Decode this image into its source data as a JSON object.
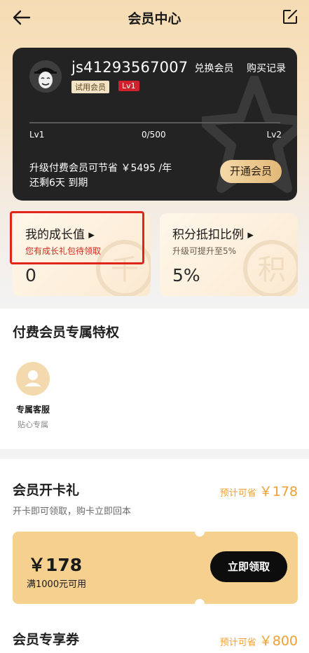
{
  "header": {
    "title": "会员中心"
  },
  "card": {
    "username": "js41293567007",
    "badge_trial": "试用会员",
    "badge_level": "Lv1",
    "link_exchange": "兑换会员",
    "link_records": "购买记录",
    "progress": {
      "current": 0,
      "max": 500
    },
    "level_left": "Lv1",
    "progress_text": "0/500",
    "level_right": "Lv2",
    "save_text": "升级付费会员可节省 ￥5495 /年",
    "remain_text": "还剩6天 到期",
    "open_btn": "开通会员"
  },
  "tiles": [
    {
      "title": "我的成长值 ▸",
      "sub": "您有成长礼包待领取",
      "value": "0",
      "sub_color": "#d42a1e"
    },
    {
      "title": "积分抵扣比例 ▸",
      "sub": "升级可提升至5%",
      "value": "5%",
      "sub_color": "#6a5a4a"
    }
  ],
  "privileges": {
    "title": "付费会员专属特权",
    "items": [
      {
        "label": "专属客服",
        "sub": "贴心专属",
        "icon": "user-icon"
      }
    ]
  },
  "card_gift": {
    "title": "会员开卡礼",
    "est_label": "预计可省",
    "est_value": "￥178",
    "sub": "开卡即可领取，购卡立即回本",
    "coupon_amount": "￥178",
    "coupon_cond": "满1000元可用",
    "coupon_btn": "立即领取"
  },
  "coupons": {
    "title": "会员专享券",
    "est_label": "预计可省",
    "est_value": "￥800"
  },
  "colors": {
    "accent": "#f0a032",
    "card_bg": "#232323",
    "coupon_bg": "#f5d08e",
    "red": "#d0222d"
  }
}
